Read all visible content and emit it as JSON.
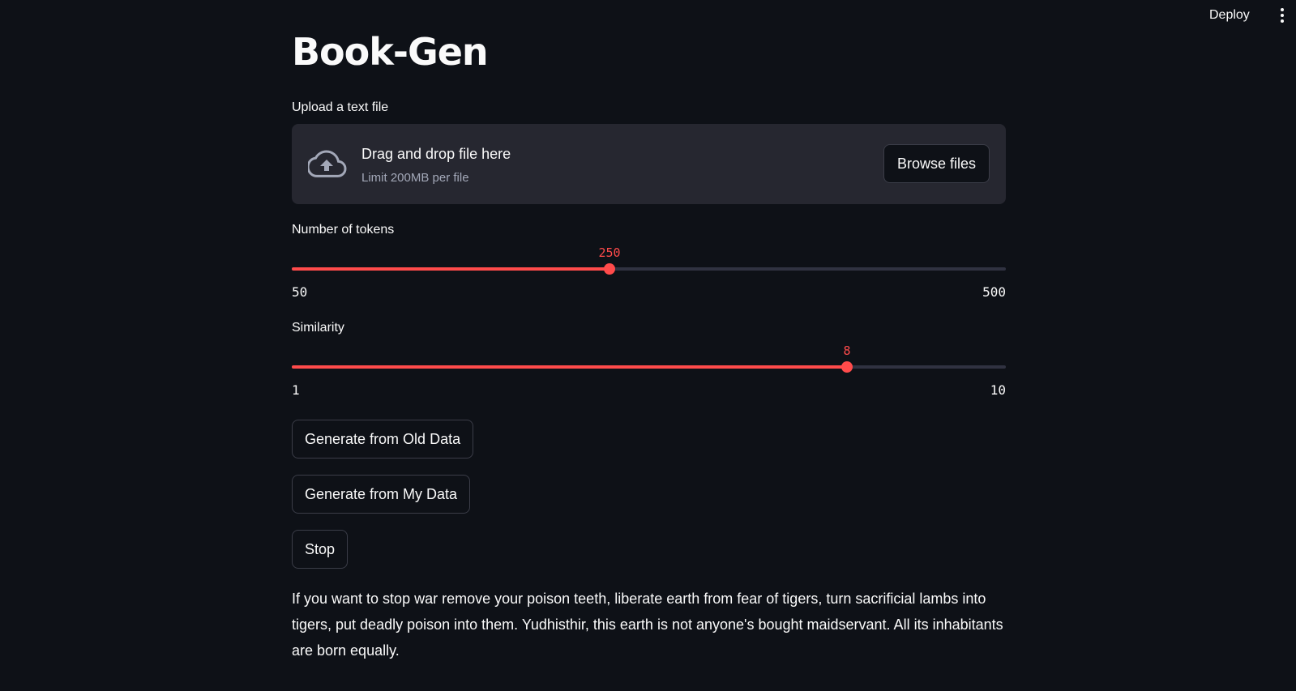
{
  "header": {
    "deploy_label": "Deploy"
  },
  "app": {
    "title": "Book-Gen"
  },
  "uploader": {
    "label": "Upload a text file",
    "drop_text": "Drag and drop file here",
    "limit_text": "Limit 200MB per file",
    "browse_label": "Browse files",
    "icon": "cloud-upload-icon"
  },
  "tokens_slider": {
    "label": "Number of tokens",
    "min": 50,
    "max": 500,
    "value": 250,
    "min_label": "50",
    "max_label": "500",
    "value_label": "250"
  },
  "similarity_slider": {
    "label": "Similarity",
    "min": 1,
    "max": 10,
    "value": 8,
    "min_label": "1",
    "max_label": "10",
    "value_label": "8"
  },
  "buttons": {
    "generate_old": "Generate from Old Data",
    "generate_mine": "Generate from My Data",
    "stop": "Stop"
  },
  "output": {
    "text": "If you want to stop war remove your poison teeth, liberate earth from fear of tigers, turn sacrificial lambs into tigers, put deadly poison into them. Yudhisthir, this earth is not anyone's bought maidservant. All its inhabitants are born equally."
  },
  "colors": {
    "background": "#0e1117",
    "accent": "#ff4b4b",
    "panel": "#262730",
    "text": "#fafafa",
    "muted_text": "#a3a8b8"
  }
}
